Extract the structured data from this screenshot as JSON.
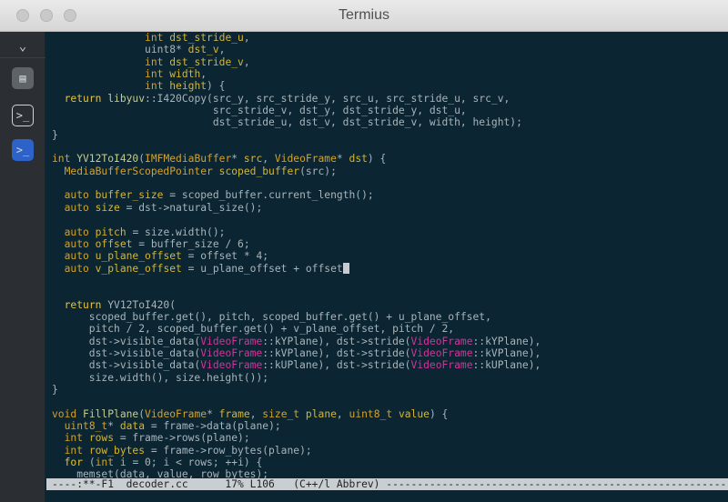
{
  "window": {
    "title": "Termius"
  },
  "sidebar": {
    "items": [
      {
        "name": "collapse",
        "icon": "chevron-down-icon",
        "glyph": "⌄"
      },
      {
        "name": "hosts",
        "icon": "hosts-icon",
        "glyph": "▤"
      },
      {
        "name": "terminal-1",
        "icon": "terminal-icon",
        "glyph": ">_"
      },
      {
        "name": "terminal-2",
        "icon": "terminal-icon",
        "glyph": ">_"
      }
    ]
  },
  "editor": {
    "lines": [
      [
        [
          "",
          "               "
        ],
        [
          "ty",
          "int"
        ],
        [
          "var",
          " dst_stride_u"
        ],
        [
          "",
          ","
        ]
      ],
      [
        [
          "",
          "               uint8* "
        ],
        [
          "var",
          "dst_v"
        ],
        [
          "",
          ","
        ]
      ],
      [
        [
          "",
          "               "
        ],
        [
          "ty",
          "int"
        ],
        [
          "var",
          " dst_stride_v"
        ],
        [
          "",
          ","
        ]
      ],
      [
        [
          "",
          "               "
        ],
        [
          "ty",
          "int"
        ],
        [
          "var",
          " width"
        ],
        [
          "",
          ","
        ]
      ],
      [
        [
          "",
          "               "
        ],
        [
          "ty",
          "int"
        ],
        [
          "var",
          " height"
        ],
        [
          "",
          ") {"
        ]
      ],
      [
        [
          "",
          "  "
        ],
        [
          "kw",
          "return"
        ],
        [
          "fn",
          " libyuv"
        ],
        [
          "",
          "::I420Copy(src_y, src_stride_y, src_u, src_stride_u, src_v,"
        ]
      ],
      [
        [
          "",
          "                          src_stride_v, dst_y, dst_stride_y, dst_u,"
        ]
      ],
      [
        [
          "",
          "                          dst_stride_u, dst_v, dst_stride_v, width, height);"
        ]
      ],
      [
        [
          "",
          "}"
        ]
      ],
      [
        [
          "",
          ""
        ]
      ],
      [
        [
          "ty",
          "int"
        ],
        [
          "fn",
          " YV12ToI420"
        ],
        [
          "",
          "("
        ],
        [
          "ty",
          "IMFMediaBuffer"
        ],
        [
          "",
          "* "
        ],
        [
          "var",
          "src"
        ],
        [
          "",
          ", "
        ],
        [
          "ty",
          "VideoFrame"
        ],
        [
          "",
          "* "
        ],
        [
          "var",
          "dst"
        ],
        [
          "",
          ") {"
        ]
      ],
      [
        [
          "",
          "  "
        ],
        [
          "ty",
          "MediaBufferScopedPointer"
        ],
        [
          "var",
          " scoped_buffer"
        ],
        [
          "",
          "(src);"
        ]
      ],
      [
        [
          "",
          ""
        ]
      ],
      [
        [
          "",
          "  "
        ],
        [
          "ty",
          "auto"
        ],
        [
          "var",
          " buffer_size"
        ],
        [
          "",
          " = scoped_buffer.current_length();"
        ]
      ],
      [
        [
          "",
          "  "
        ],
        [
          "ty",
          "auto"
        ],
        [
          "var",
          " size"
        ],
        [
          "",
          " = dst->natural_size();"
        ]
      ],
      [
        [
          "",
          ""
        ]
      ],
      [
        [
          "",
          "  "
        ],
        [
          "ty",
          "auto"
        ],
        [
          "var",
          " pitch"
        ],
        [
          "",
          " = size.width();"
        ]
      ],
      [
        [
          "",
          "  "
        ],
        [
          "ty",
          "auto"
        ],
        [
          "var",
          " offset"
        ],
        [
          "",
          " = buffer_size / 6;"
        ]
      ],
      [
        [
          "",
          "  "
        ],
        [
          "ty",
          "auto"
        ],
        [
          "var",
          " u_plane_offset"
        ],
        [
          "",
          " = offset * 4;"
        ]
      ],
      [
        [
          "",
          "  "
        ],
        [
          "ty",
          "auto"
        ],
        [
          "var",
          " v_plane_offset"
        ],
        [
          "",
          " = u_plane_offset + offset"
        ],
        [
          "cursor",
          ""
        ]
      ],
      [
        [
          "",
          ""
        ]
      ],
      [
        [
          "",
          ""
        ]
      ],
      [
        [
          "",
          "  "
        ],
        [
          "kw",
          "return"
        ],
        [
          "",
          " YV12ToI420("
        ]
      ],
      [
        [
          "",
          "      scoped_buffer.get(), pitch, scoped_buffer.get() + u_plane_offset,"
        ]
      ],
      [
        [
          "",
          "      pitch / 2, scoped_buffer.get() + v_plane_offset, pitch / 2,"
        ]
      ],
      [
        [
          "",
          "      dst->visible_data("
        ],
        [
          "vf",
          "VideoFrame"
        ],
        [
          "",
          "::kYPlane), dst->stride("
        ],
        [
          "vf",
          "VideoFrame"
        ],
        [
          "",
          "::kYPlane),"
        ]
      ],
      [
        [
          "",
          "      dst->visible_data("
        ],
        [
          "vf",
          "VideoFrame"
        ],
        [
          "",
          "::kVPlane), dst->stride("
        ],
        [
          "vf",
          "VideoFrame"
        ],
        [
          "",
          "::kVPlane),"
        ]
      ],
      [
        [
          "",
          "      dst->visible_data("
        ],
        [
          "vf",
          "VideoFrame"
        ],
        [
          "",
          "::kUPlane), dst->stride("
        ],
        [
          "vf",
          "VideoFrame"
        ],
        [
          "",
          "::kUPlane),"
        ]
      ],
      [
        [
          "",
          "      size.width(), size.height());"
        ]
      ],
      [
        [
          "",
          "}"
        ]
      ],
      [
        [
          "",
          ""
        ]
      ],
      [
        [
          "ty",
          "void"
        ],
        [
          "fn",
          " FillPlane"
        ],
        [
          "",
          "("
        ],
        [
          "ty",
          "VideoFrame"
        ],
        [
          "",
          "* "
        ],
        [
          "var",
          "frame"
        ],
        [
          "",
          ", "
        ],
        [
          "ty",
          "size_t"
        ],
        [
          "var",
          " plane"
        ],
        [
          "",
          ", "
        ],
        [
          "ty",
          "uint8_t"
        ],
        [
          "var",
          " value"
        ],
        [
          "",
          ") {"
        ]
      ],
      [
        [
          "",
          "  "
        ],
        [
          "ty",
          "uint8_t"
        ],
        [
          "",
          "* "
        ],
        [
          "var",
          "data"
        ],
        [
          "",
          " = frame->data(plane);"
        ]
      ],
      [
        [
          "",
          "  "
        ],
        [
          "ty",
          "int"
        ],
        [
          "var",
          " rows"
        ],
        [
          "",
          " = frame->rows(plane);"
        ]
      ],
      [
        [
          "",
          "  "
        ],
        [
          "ty",
          "int"
        ],
        [
          "var",
          " row_bytes"
        ],
        [
          "",
          " = frame->row_bytes(plane);"
        ]
      ],
      [
        [
          "",
          "  "
        ],
        [
          "kw",
          "for"
        ],
        [
          "",
          " ("
        ],
        [
          "ty",
          "int"
        ],
        [
          "var",
          " i"
        ],
        [
          "",
          " = 0; i < rows; ++i) {"
        ]
      ],
      [
        [
          "",
          "    memset(data, value, row_bytes);"
        ]
      ]
    ]
  },
  "modeline": {
    "text": "----:**-F1  decoder.cc      17% L106   (C++/l Abbrev) -----------------------------------------------------------------"
  },
  "colors": {
    "editor_bg": "#0b2632",
    "keyword": "#e8c23a",
    "type": "#d4a12a",
    "function": "#c5cc8f",
    "enum_scope": "#d0359b",
    "active_tab": "#2d63c8"
  }
}
